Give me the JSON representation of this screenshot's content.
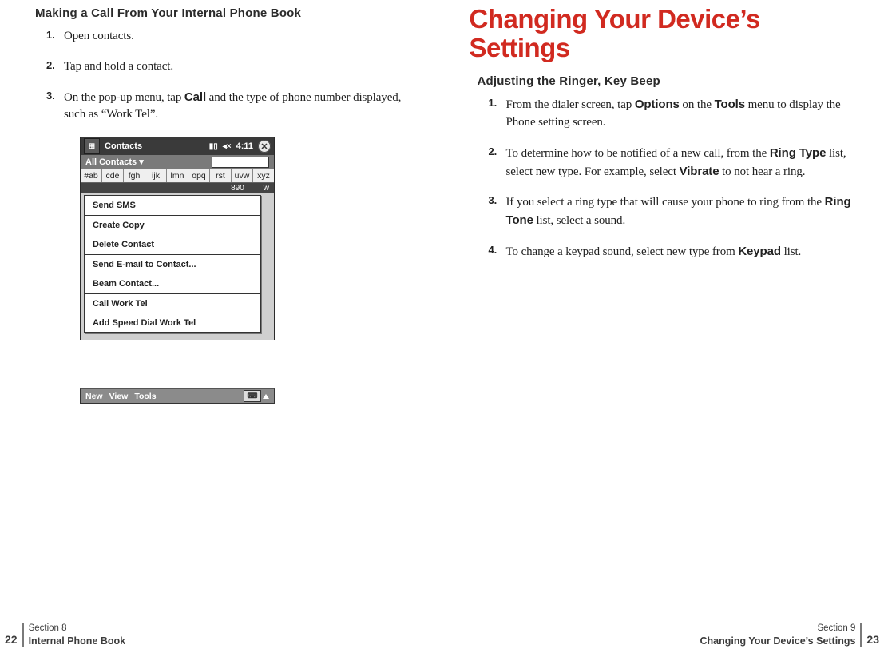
{
  "left": {
    "heading": "Making a Call From Your Internal Phone Book",
    "steps": {
      "s1": "Open contacts.",
      "s2": "Tap and hold a contact.",
      "s3a": "On the pop-up menu, tap ",
      "s3b": "Call",
      "s3c": " and the type of phone number displayed, such as “Work Tel”."
    },
    "footer": {
      "page": "22",
      "section": "Section 8",
      "title": "Internal Phone Book"
    }
  },
  "device": {
    "app": "Contacts",
    "time": "4:11",
    "signal": "▮▯",
    "vol": "◂×",
    "close": "✕",
    "flag": "⊞",
    "category": "All Contacts ▾",
    "tabs": {
      "t1": "#ab",
      "t2": "cde",
      "t3": "fgh",
      "t4": "ijk",
      "t5": "lmn",
      "t6": "opq",
      "t7": "rst",
      "t8": "uvw",
      "t9": "xyz"
    },
    "numrow": {
      "a": "890",
      "b": "w"
    },
    "popup": {
      "i1": "Send SMS",
      "i2": "Create Copy",
      "i3": "Delete Contact",
      "i4": "Send E-mail to Contact...",
      "i5": "Beam Contact...",
      "i6": "Call Work Tel",
      "i7": "Add Speed Dial Work Tel"
    },
    "softkeys": {
      "k1": "New",
      "k2": "View",
      "k3": "Tools",
      "kbd": "⌨"
    }
  },
  "right": {
    "chapter": "Changing Your Device’s Settings",
    "heading": "Adjusting the Ringer, Key Beep",
    "steps": {
      "s1a": "From the dialer screen, tap ",
      "s1b": "Options",
      "s1c": " on the ",
      "s1d": "Tools",
      "s1e": " menu to display the Phone setting screen.",
      "s2a": "To determine how to be notified of a new call, from the ",
      "s2b": "Ring Type",
      "s2c": " list, select new type. For example, select ",
      "s2d": "Vibrate",
      "s2e": " to not hear a ring.",
      "s3a": "If you select a ring type that will cause your phone to ring from the ",
      "s3b": "Ring Tone",
      "s3c": " list, select a sound.",
      "s4a": "To change a keypad sound, select new type from ",
      "s4b": "Keypad",
      "s4c": " list."
    },
    "footer": {
      "page": "23",
      "section": "Section 9",
      "title": "Changing Your Device’s Settings"
    }
  }
}
